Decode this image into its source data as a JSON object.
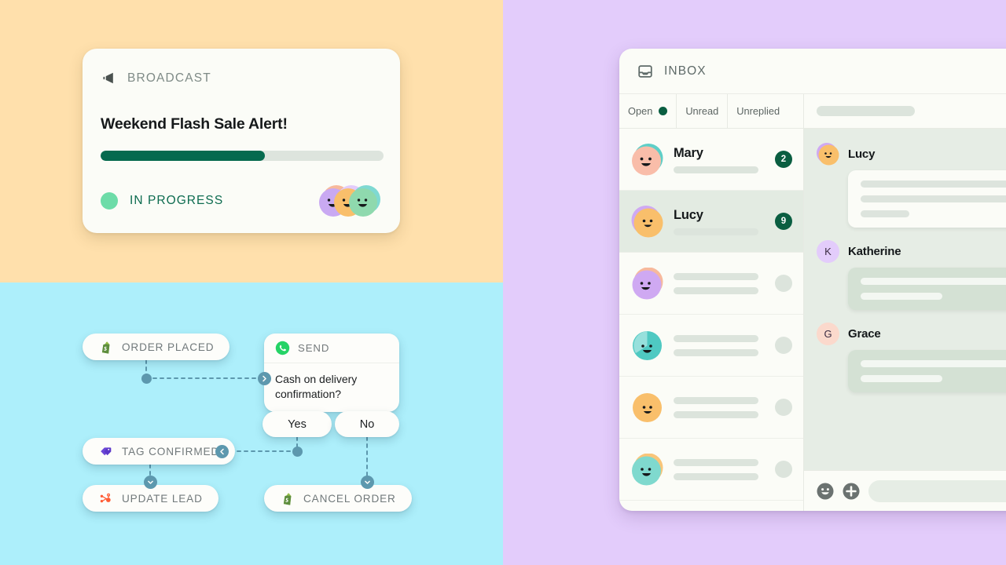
{
  "background": {
    "top_left_color": "#FFE0AC",
    "bottom_left_color": "#ADEFFB",
    "right_color": "#E3CCFB"
  },
  "broadcast": {
    "header_label": "BROADCAST",
    "header_icon": "megaphone-icon",
    "title": "Weekend Flash Sale Alert!",
    "progress_percent": 58,
    "progress_fill_color": "#056A4E",
    "progress_track_color": "#DDE4DD",
    "status_label": "IN PROGRESS",
    "status_dot_color": "#6DDCA8",
    "status_text_color": "#0C6B4F",
    "avatars": [
      {
        "name": "avatar-purple",
        "face": "#C9A9F2",
        "accent": "#F7B99C"
      },
      {
        "name": "avatar-orange",
        "face": "#F9BF6B",
        "accent": "#E3CCFB"
      },
      {
        "name": "avatar-green",
        "face": "#8FD9AE",
        "accent": "#7FD9D2"
      }
    ]
  },
  "flow": {
    "nodes": [
      {
        "id": "order-placed",
        "label": "ORDER PLACED",
        "icon": "shopify-icon"
      },
      {
        "id": "tag-confirmed",
        "label": "TAG CONFIRMED",
        "icon": "tag-icon"
      },
      {
        "id": "update-lead",
        "label": "UPDATE LEAD",
        "icon": "hubspot-icon"
      },
      {
        "id": "cancel-order",
        "label": "CANCEL ORDER",
        "icon": "shopify-icon"
      }
    ],
    "send_card": {
      "header_label": "SEND",
      "header_icon": "whatsapp-icon",
      "message": "Cash on delivery confirmation?"
    },
    "choices": [
      {
        "id": "yes",
        "label": "Yes"
      },
      {
        "id": "no",
        "label": "No"
      }
    ],
    "connector_color": "#5D98AE"
  },
  "inbox": {
    "header_label": "INBOX",
    "header_icon": "inbox-tray-icon",
    "tabs": [
      {
        "label": "Open",
        "has_dot": true,
        "active": true
      },
      {
        "label": "Unread",
        "has_dot": false,
        "active": false
      },
      {
        "label": "Unreplied",
        "has_dot": false,
        "active": false
      }
    ],
    "tab_dot_color": "#0A5E41",
    "assign_icon": "assign-users-icon",
    "conversations": [
      {
        "name": "Mary",
        "badge": "2",
        "active": false,
        "face": "#F9BDA9",
        "accent": "#5ECFC8"
      },
      {
        "name": "Lucy",
        "badge": "9",
        "active": true,
        "face": "#F9BF6B",
        "accent": "#CFA9F2"
      },
      {
        "name": "",
        "badge": "",
        "active": false,
        "face": "#CFA9F2",
        "accent": "#F7B99C"
      },
      {
        "name": "",
        "badge": "",
        "active": false,
        "face": "#4FC9C2",
        "accent": "#97E0DC"
      },
      {
        "name": "",
        "badge": "",
        "active": false,
        "face": "#F9BF6B",
        "accent": "#F9BF6B"
      },
      {
        "name": "",
        "badge": "",
        "active": false,
        "face": "#7FD9CE",
        "accent": "#F9C579"
      }
    ],
    "thread": [
      {
        "sender": "Lucy",
        "avatar_type": "face",
        "face": "#F9BF6B",
        "accent": "#CFA9F2",
        "bubble": "white",
        "lines": 3
      },
      {
        "sender": "Katherine",
        "avatar_type": "initial",
        "initial": "K",
        "bg": "#E3CCFB",
        "bubble": "tint",
        "lines": 2
      },
      {
        "sender": "Grace",
        "avatar_type": "initial",
        "initial": "G",
        "bg": "#FBD9CC",
        "bubble": "tint",
        "lines": 2
      }
    ],
    "composer": {
      "emoji_icon": "emoji-smiley-icon",
      "attach_icon": "plus-circle-icon",
      "input_placeholder": ""
    }
  }
}
